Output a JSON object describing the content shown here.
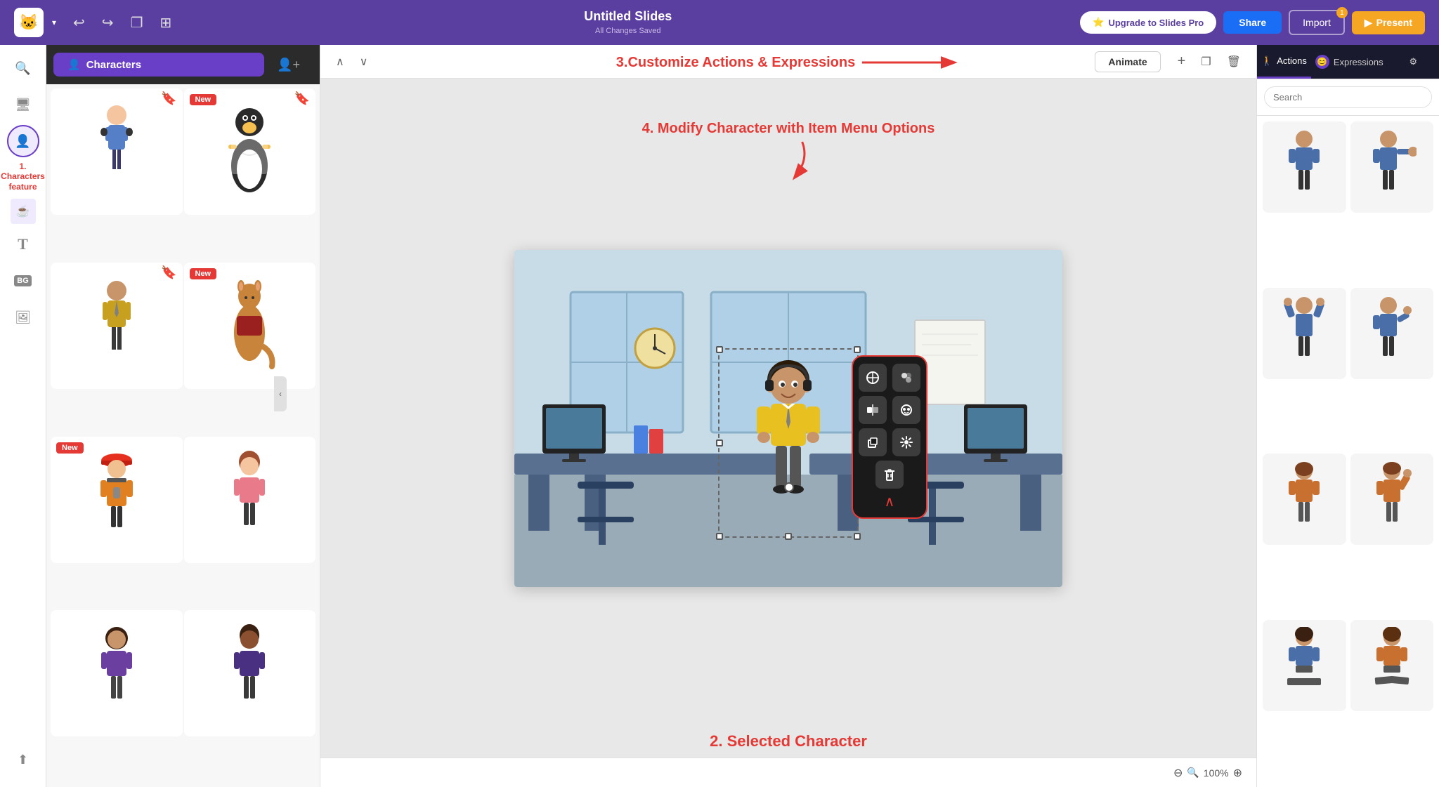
{
  "app": {
    "logo": "🐱",
    "title": "Untitled Slides",
    "subtitle": "All Changes Saved"
  },
  "toolbar": {
    "undo": "↩",
    "redo": "↪",
    "duplicate": "❐",
    "divider": "|",
    "upgrade_label": "Upgrade to Slides Pro",
    "share_label": "Share",
    "import_label": "Import",
    "import_badge": "1",
    "present_label": "Present"
  },
  "sidebar": {
    "items": [
      {
        "id": "search",
        "icon": "🔍",
        "label": ""
      },
      {
        "id": "slides",
        "icon": "🖥",
        "label": ""
      },
      {
        "id": "characters",
        "icon": "👤",
        "label": ""
      },
      {
        "id": "text",
        "icon": "T",
        "label": ""
      },
      {
        "id": "background",
        "icon": "BG",
        "label": ""
      },
      {
        "id": "images",
        "icon": "🖼",
        "label": ""
      },
      {
        "id": "upload",
        "icon": "⬆",
        "label": ""
      }
    ]
  },
  "panel": {
    "tab_characters": "Characters",
    "tab_add": "+",
    "characters_label": "Characters feature",
    "new_badge": "New"
  },
  "canvas": {
    "animate_label": "Animate",
    "zoom_label": "100%",
    "zoom_icon": "🔍",
    "annotation_2": "2. Selected Character",
    "annotation_3": "3.Customize Actions & Expressions",
    "annotation_4": "4. Modify Character with Item Menu Options",
    "annotation_1_line1": "1. Characters",
    "annotation_1_line2": "feature",
    "arrow_right": "→",
    "arrow_down_left": "↙"
  },
  "right_panel": {
    "tab_actions": "Actions",
    "tab_expressions": "Expressions",
    "search_placeholder": "Search",
    "actions_icon": "🚶",
    "expressions_icon": "😊"
  },
  "characters": [
    {
      "id": 1,
      "label": "Headset man",
      "new": false,
      "bookmarked": true,
      "color": "#6a8fc8"
    },
    {
      "id": 2,
      "label": "Penguin doctor",
      "new": true,
      "bookmarked": true,
      "color": "#4a9f7a"
    },
    {
      "id": 3,
      "label": "Business man",
      "new": false,
      "bookmarked": true,
      "color": "#c8a020"
    },
    {
      "id": 4,
      "label": "Kangaroo",
      "new": true,
      "bookmarked": false,
      "color": "#b07040"
    },
    {
      "id": 5,
      "label": "Firefighter",
      "new": true,
      "bookmarked": false,
      "color": "#e53020"
    },
    {
      "id": 6,
      "label": "Pink woman",
      "new": false,
      "bookmarked": false,
      "color": "#e08080"
    },
    {
      "id": 7,
      "label": "Curly woman",
      "new": false,
      "bookmarked": false,
      "color": "#8060a0"
    },
    {
      "id": 8,
      "label": "Dark woman",
      "new": false,
      "bookmarked": false,
      "color": "#604080"
    }
  ],
  "right_characters": [
    {
      "id": 1,
      "pose": "standing",
      "color": "#4a6ea8"
    },
    {
      "id": 2,
      "pose": "pointing",
      "color": "#4a6ea8"
    },
    {
      "id": 3,
      "pose": "hands_up",
      "color": "#4a6ea8"
    },
    {
      "id": 4,
      "pose": "presenting",
      "color": "#4a6ea8"
    },
    {
      "id": 5,
      "pose": "casual",
      "color": "#7a5020"
    },
    {
      "id": 6,
      "pose": "waving",
      "color": "#7a5020"
    },
    {
      "id": 7,
      "pose": "sitting",
      "color": "#4a6ea8"
    },
    {
      "id": 8,
      "pose": "relaxed",
      "color": "#7a5020"
    }
  ]
}
